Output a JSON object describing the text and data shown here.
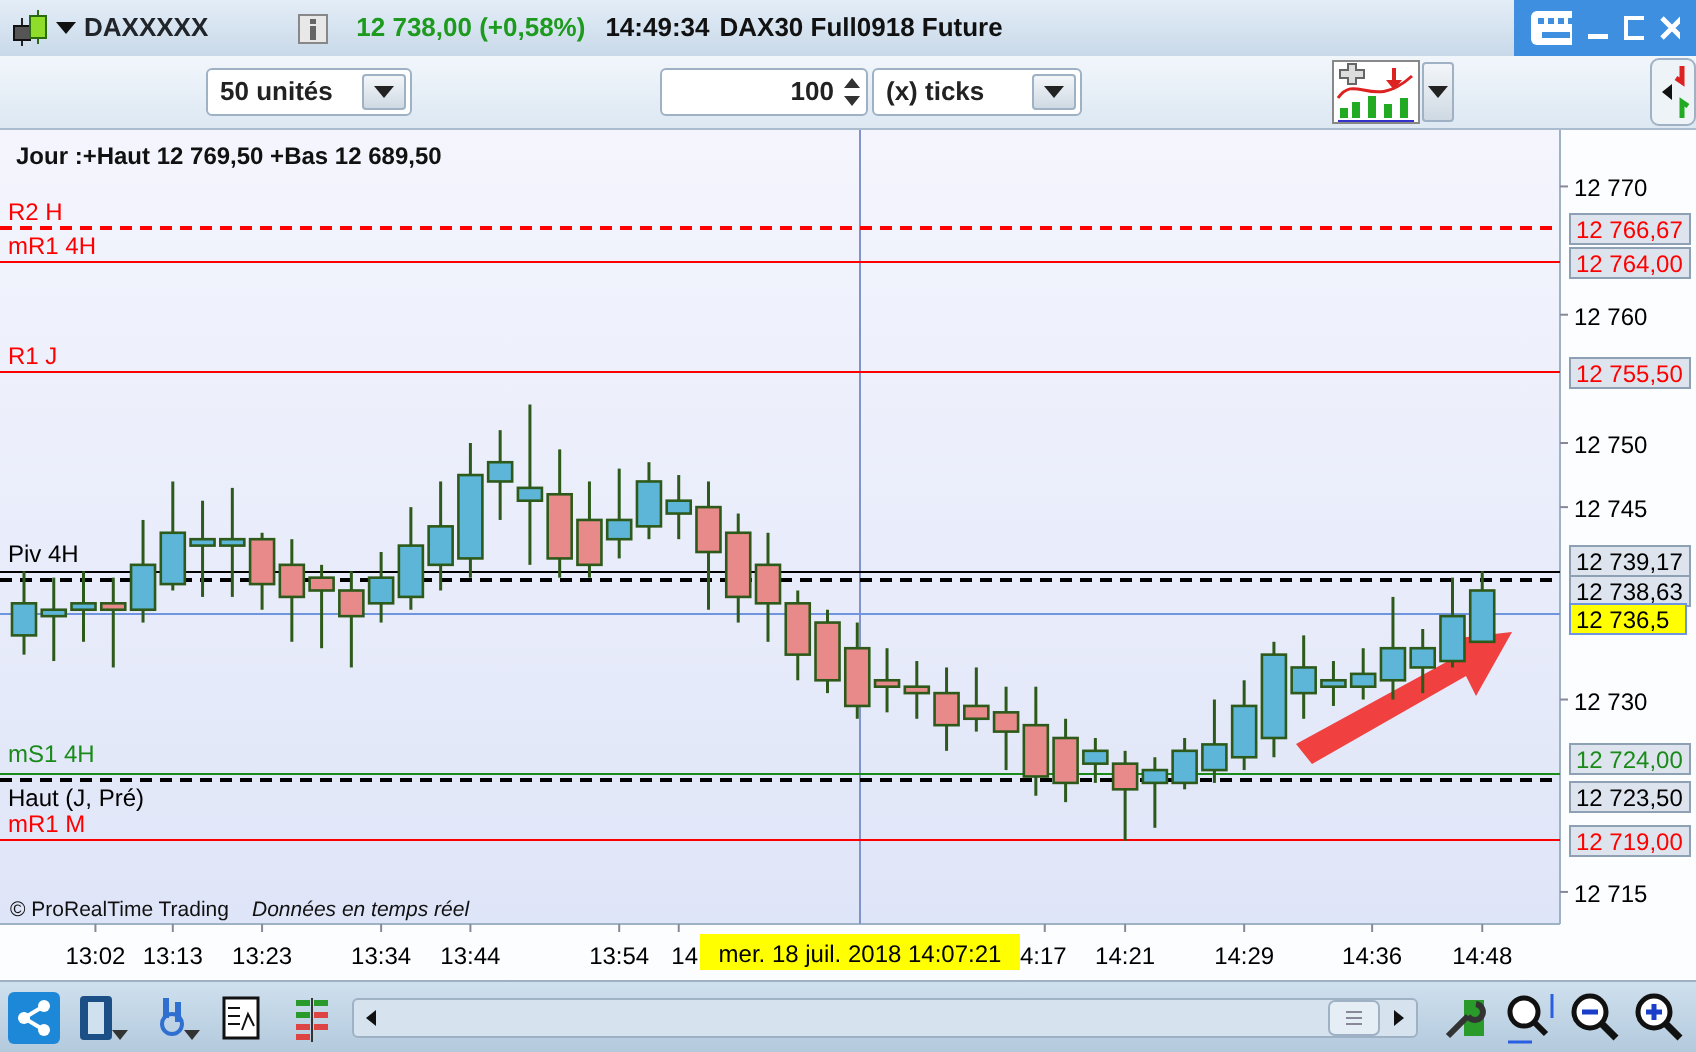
{
  "title_bar": {
    "symbol": "DAXXXXX",
    "quote": "12 738,00 (+0,58%)",
    "time": "14:49:34",
    "instrument": "DAX30 Full0918 Future"
  },
  "toolbar": {
    "units_select": "50 unités",
    "ticks_value": "100",
    "ticks_select": "(x) ticks"
  },
  "chart": {
    "header": "Jour :+Haut 12 769,50 +Bas 12 689,50",
    "levels": [
      {
        "label": "R2 H",
        "value": "12 766,67",
        "kind": "dashed",
        "color": "#ff0000"
      },
      {
        "label": "mR1 4H",
        "value": "12 764,00",
        "kind": "solid",
        "color": "#ff0000"
      },
      {
        "label": "R1 J",
        "value": "12 755,50",
        "kind": "solid",
        "color": "#ff0000"
      },
      {
        "value": "12 739,17",
        "kind": "solid",
        "color": "#000000"
      },
      {
        "label": "Piv 4H",
        "value": "12 738,63",
        "kind": "dashed",
        "color": "#000000"
      },
      {
        "value": "12 736,5",
        "kind": "current",
        "color": "#6f94e0"
      },
      {
        "label": "mS1 4H",
        "value": "12 724,00",
        "kind": "solid",
        "color": "#1a8a1a"
      },
      {
        "label": "Haut (J, Pré)",
        "value": "12 723,50",
        "kind": "dashed",
        "color": "#000000"
      },
      {
        "label": "mR1 M",
        "value": "12 719,00",
        "kind": "solid",
        "color": "#ff0000"
      }
    ],
    "chart_data": {
      "type": "candlestick",
      "ylim": [
        12712.5,
        12774.4
      ],
      "ohlc": [
        [
          12735,
          12740,
          12733.5,
          12737.5
        ],
        [
          12736.5,
          12739.5,
          12733,
          12737
        ],
        [
          12737,
          12740,
          12734.5,
          12737.5
        ],
        [
          12737.5,
          12739.5,
          12732.5,
          12737
        ],
        [
          12737,
          12744,
          12736,
          12740.5
        ],
        [
          12739,
          12747,
          12738.5,
          12743
        ],
        [
          12742,
          12745.5,
          12738,
          12742.5
        ],
        [
          12742,
          12746.5,
          12738,
          12742.5
        ],
        [
          12742.5,
          12743,
          12737,
          12739
        ],
        [
          12740.5,
          12742.5,
          12734.5,
          12738
        ],
        [
          12739.5,
          12740.5,
          12734,
          12738.5
        ],
        [
          12738.5,
          12740,
          12732.5,
          12736.5
        ],
        [
          12737.5,
          12741.5,
          12736,
          12739.5
        ],
        [
          12738,
          12745,
          12737,
          12742
        ],
        [
          12740.5,
          12747,
          12738.5,
          12743.5
        ],
        [
          12741,
          12750,
          12739.5,
          12747.5
        ],
        [
          12747,
          12751,
          12744,
          12748.5
        ],
        [
          12745.5,
          12753,
          12740.5,
          12746.5
        ],
        [
          12746,
          12749.5,
          12739.5,
          12741
        ],
        [
          12744,
          12747,
          12739.5,
          12740.5
        ],
        [
          12742.5,
          12748,
          12741,
          12744
        ],
        [
          12743.5,
          12748.5,
          12742.5,
          12747
        ],
        [
          12744.5,
          12747.5,
          12742.5,
          12745.5
        ],
        [
          12745,
          12747,
          12737,
          12741.5
        ],
        [
          12743,
          12744.5,
          12736,
          12738
        ],
        [
          12740.5,
          12743,
          12734.5,
          12737.5
        ],
        [
          12737.5,
          12738.5,
          12731.5,
          12733.5
        ],
        [
          12736,
          12737,
          12730.5,
          12731.5
        ],
        [
          12734,
          12736,
          12728.5,
          12729.5
        ],
        [
          12731.5,
          12734,
          12729,
          12731
        ],
        [
          12731,
          12733,
          12728.5,
          12730.5
        ],
        [
          12730.5,
          12732.5,
          12726,
          12728
        ],
        [
          12729.5,
          12732.5,
          12727.5,
          12728.5
        ],
        [
          12729,
          12731,
          12724.5,
          12727.5
        ],
        [
          12728,
          12731,
          12722.5,
          12724
        ],
        [
          12727,
          12728.5,
          12722,
          12723.5
        ],
        [
          12725,
          12727,
          12723.5,
          12726
        ],
        [
          12725,
          12726,
          12719,
          12723
        ],
        [
          12723.5,
          12725.5,
          12720,
          12724.5
        ],
        [
          12723.5,
          12727,
          12723,
          12726
        ],
        [
          12724.5,
          12730,
          12723.5,
          12726.5
        ],
        [
          12725.5,
          12731.5,
          12724.5,
          12729.5
        ],
        [
          12727,
          12734.5,
          12725.5,
          12733.5
        ],
        [
          12730.5,
          12735,
          12728.5,
          12732.5
        ],
        [
          12731,
          12733,
          12729.5,
          12731.5
        ],
        [
          12731,
          12734,
          12730,
          12732
        ],
        [
          12731.5,
          12738,
          12730,
          12734
        ],
        [
          12732.5,
          12735.5,
          12730.5,
          12734
        ],
        [
          12733,
          12739.5,
          12732.5,
          12736.5
        ],
        [
          12734.5,
          12740,
          12734.5,
          12738.5
        ]
      ],
      "yticks": [
        {
          "value": 12770,
          "label": "12 770"
        },
        {
          "value": 12760,
          "label": "12 760"
        },
        {
          "value": 12750,
          "label": "12 750"
        },
        {
          "value": 12745,
          "label": "12 745"
        },
        {
          "value": 12730,
          "label": "12 730"
        },
        {
          "value": 12715,
          "label": "12 715"
        }
      ]
    },
    "x_labels": [
      "13:02",
      "13:13",
      "13:23",
      "13:34",
      "13:44",
      "13:54",
      "14",
      "4:17",
      "14:21",
      "14:29",
      "14:36",
      "14:48"
    ],
    "crosshair_label": "mer. 18 juil. 2018 14:07:21",
    "copyright": "© ProRealTime Trading",
    "feed_note": "Données en temps réel"
  }
}
